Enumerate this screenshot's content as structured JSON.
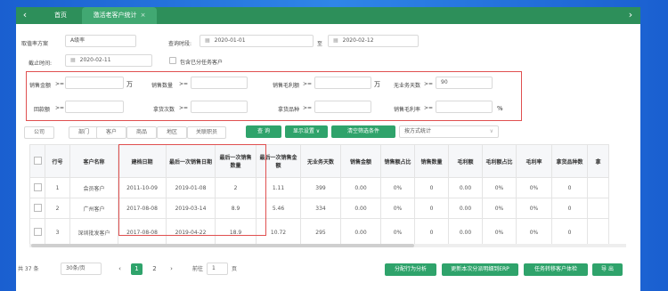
{
  "tabs": {
    "home": "首页",
    "active": "激活老客户统计",
    "close": "×"
  },
  "nav": {
    "back": "‹",
    "forward": "›"
  },
  "filters": {
    "plan_label": "取值率方案",
    "plan_value": "A级率",
    "query_time_label": "查询时段:",
    "date_from": "2020-01-01",
    "to": "至",
    "date_to": "2020-02-12",
    "deadline_label": "截止时间:",
    "deadline": "2020-02-11",
    "include_label": "包含已分任务客户"
  },
  "conditions": [
    {
      "label": "销售金额",
      "op": ">=",
      "value": "",
      "unit": "万"
    },
    {
      "label": "销售数量",
      "op": ">=",
      "value": "",
      "unit": ""
    },
    {
      "label": "销售毛利额",
      "op": ">=",
      "value": "",
      "unit": "万"
    },
    {
      "label": "无业务天数",
      "op": ">=",
      "value": "90",
      "unit": ""
    },
    {
      "label": "回款额",
      "op": ">=",
      "value": "",
      "unit": ""
    },
    {
      "label": "拿货次数",
      "op": ">=",
      "value": "",
      "unit": ""
    },
    {
      "label": "拿货品种",
      "op": ">=",
      "value": "",
      "unit": ""
    },
    {
      "label": "销售毛利率",
      "op": ">=",
      "value": "",
      "unit": "%"
    }
  ],
  "toolbar": {
    "filters": [
      "公司",
      "部门",
      "客户",
      "商品",
      "地区",
      "关联职员"
    ],
    "query": "查 询",
    "display": "显示设置 ∨",
    "clear": "清空筛选条件",
    "stat_mode": "按方式统计",
    "stat_arrow": "∨"
  },
  "table": {
    "headers": [
      "",
      "行号",
      "客户名称",
      "建档日期",
      "最后一次销售日期",
      "最后一次销售数量",
      "最后一次销售金额",
      "无业务天数",
      "销售金额",
      "销售额占比",
      "销售数量",
      "毛利额",
      "毛利额占比",
      "毛利率",
      "拿货品种数",
      "拿"
    ],
    "rows": [
      [
        "",
        "1",
        "会员客户",
        "2011-10-09",
        "2019-01-08",
        "2",
        "1.11",
        "399",
        "0.00",
        "0%",
        "0",
        "0.00",
        "0%",
        "0%",
        "0",
        ""
      ],
      [
        "",
        "2",
        "广州客户",
        "2017-08-08",
        "2019-03-14",
        "8.9",
        "5.46",
        "334",
        "0.00",
        "0%",
        "0",
        "0.00",
        "0%",
        "0%",
        "0",
        ""
      ],
      [
        "",
        "3",
        "深圳批发客户",
        "2017-08-08",
        "2019-04-22",
        "18.9",
        "10.72",
        "295",
        "0.00",
        "0%",
        "0",
        "0.00",
        "0%",
        "0%",
        "0",
        ""
      ]
    ]
  },
  "pagination": {
    "total": "共 37 条",
    "page_size": "30条/页",
    "prev": "‹",
    "pages": [
      "1",
      "2"
    ],
    "next": "›",
    "goto_label": "前往",
    "goto_value": "1",
    "page_unit": "页"
  },
  "actions": [
    "分配行为分析",
    "更新本次分派明细到ERP",
    "任务转移客户体检",
    "导 出"
  ],
  "colors": {
    "brand": "#2d8f5a",
    "accent": "#2fa36b",
    "highlight": "#e05050"
  }
}
